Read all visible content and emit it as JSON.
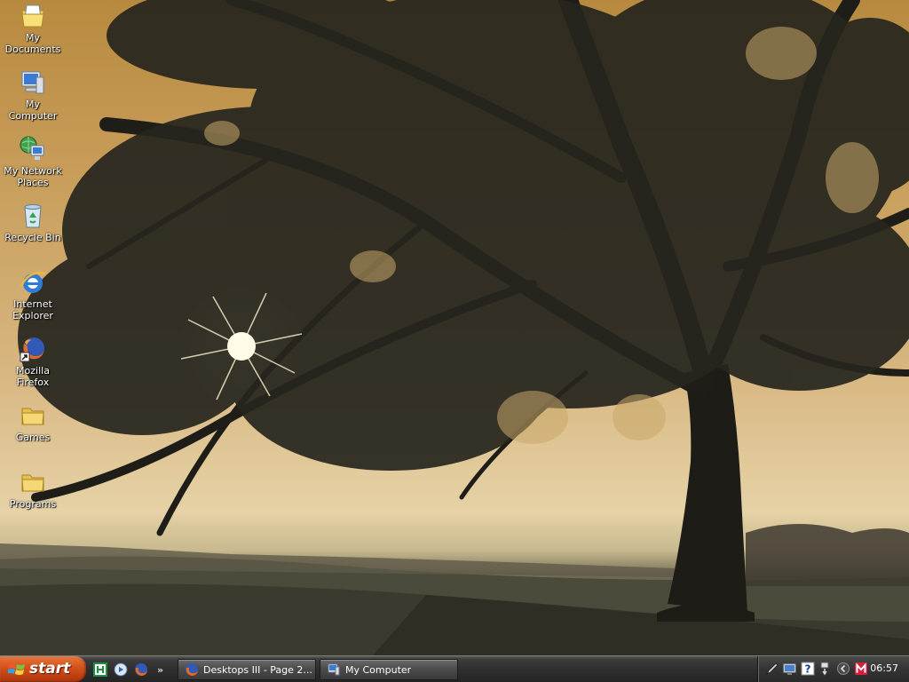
{
  "desktop": {
    "icons": [
      {
        "label": "My Documents",
        "icon": "my-documents-icon"
      },
      {
        "label": "My Computer",
        "icon": "my-computer-icon"
      },
      {
        "label": "My Network Places",
        "icon": "network-places-icon"
      },
      {
        "label": "Recycle Bin",
        "icon": "recycle-bin-icon"
      },
      {
        "label": "Internet Explorer",
        "icon": "internet-explorer-icon"
      },
      {
        "label": "Mozilla Firefox",
        "icon": "firefox-shortcut-icon"
      },
      {
        "label": "Games",
        "icon": "folder-icon"
      },
      {
        "label": "Programs",
        "icon": "folder-icon"
      }
    ]
  },
  "taskbar": {
    "start_label": "start",
    "quick_launch_more": "»",
    "quick_launch": [
      {
        "icon": "green-app-icon"
      },
      {
        "icon": "media-player-icon"
      },
      {
        "icon": "firefox-icon"
      }
    ],
    "tasks": [
      {
        "label": "Desktops III - Page 2...",
        "icon": "firefox-icon"
      },
      {
        "label": "My Computer",
        "icon": "my-computer-icon"
      }
    ],
    "tray": {
      "icons": [
        "pen-tool-icon",
        "display-icon",
        "help-icon",
        "safely-remove-icon",
        "collapse-arrow-icon",
        "m-app-icon"
      ],
      "clock": "06:57"
    }
  },
  "colors": {
    "start_button": "#d4541c",
    "taskbar": "#2e2e2e",
    "sky": "#d6b57e"
  }
}
